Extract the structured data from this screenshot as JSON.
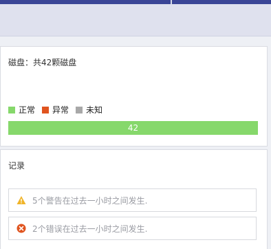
{
  "disk_panel": {
    "title": "磁盘：共42颗磁盘",
    "legend": [
      {
        "label": "正常",
        "color": "#86d86b"
      },
      {
        "label": "异常",
        "color": "#e0541f"
      },
      {
        "label": "未知",
        "color": "#a8a8a8"
      }
    ],
    "bar": {
      "normal_count": "42",
      "normal_fraction": 1.0
    }
  },
  "log_panel": {
    "title": "记录",
    "alerts": [
      {
        "text": "5个警告在过去一小时之间发生.",
        "icon": "warning-icon",
        "color": "#f0b429"
      },
      {
        "text": "2个错误在过去一小时之间发生.",
        "icon": "error-icon",
        "color": "#e0541f"
      }
    ]
  }
}
